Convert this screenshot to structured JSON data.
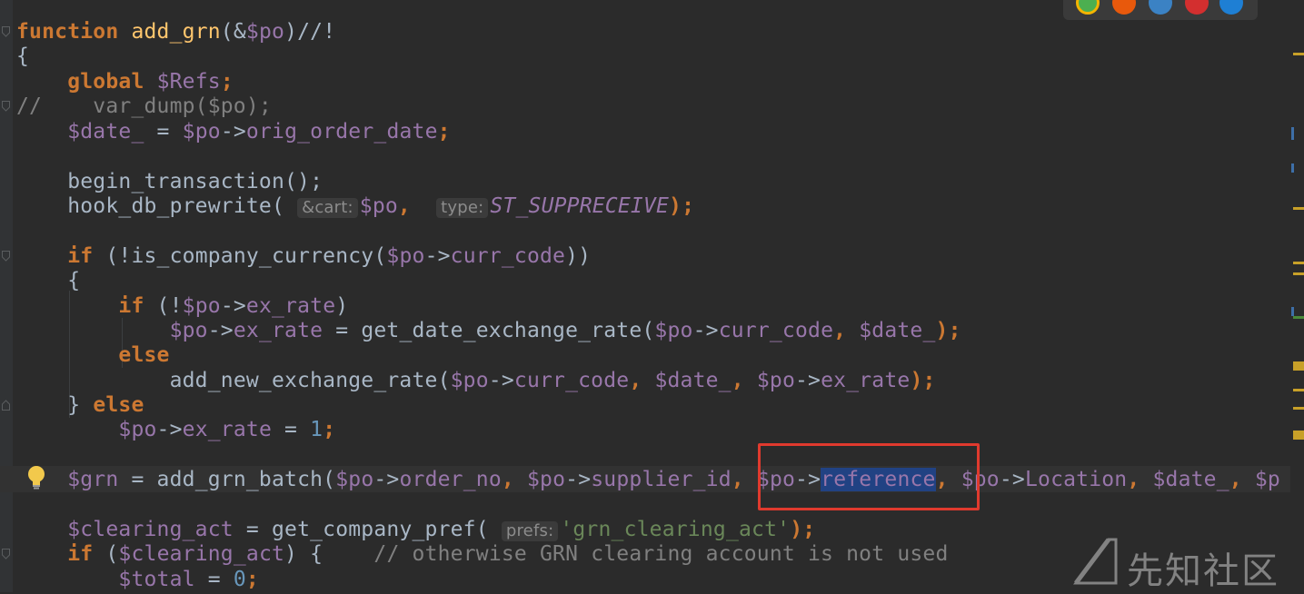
{
  "code": {
    "l1": {
      "kw": "function",
      "fn": "add_grn",
      "a": "(&",
      "v": "$po",
      "b": ")//!"
    },
    "l2": "{",
    "l3": {
      "kw": "global",
      "v": "$Refs",
      "b": ";"
    },
    "l4": {
      "c": "//    var_dump($po);"
    },
    "l5": {
      "v1": "$date_",
      "a": " = ",
      "v2": "$po",
      "arrow": "->",
      "p": "orig_order_date",
      "b": ";"
    },
    "l7": {
      "a": "begin_transaction();"
    },
    "l8": {
      "a": "hook_db_prewrite(",
      "h1": "&cart:",
      "v": "$po",
      "b": ",",
      "h2": "type:",
      "c": "ST_SUPPRECEIVE",
      "d": ");"
    },
    "l10": {
      "kw": "if",
      "a": " (!is_company_currency(",
      "v": "$po",
      "arrow": "->",
      "p": "curr_code",
      "b": "))"
    },
    "l11": "{",
    "l12": {
      "kw": "if",
      "a": " (!",
      "v": "$po",
      "arrow": "->",
      "p": "ex_rate",
      "b": ")"
    },
    "l13": {
      "v1": "$po",
      "arrow1": "->",
      "p1": "ex_rate",
      "a": " = get_date_exchange_rate(",
      "v2": "$po",
      "arrow2": "->",
      "p2": "curr_code",
      "b": ", ",
      "v3": "$date_",
      "c": ");"
    },
    "l14": {
      "kw": "else"
    },
    "l15": {
      "a": "add_new_exchange_rate(",
      "v1": "$po",
      "arrow1": "->",
      "p1": "curr_code",
      "b": ", ",
      "v2": "$date_",
      "c": ", ",
      "v3": "$po",
      "arrow2": "->",
      "p2": "ex_rate",
      "d": ");"
    },
    "l16": {
      "a": "} ",
      "kw": "else"
    },
    "l17": {
      "v": "$po",
      "arrow": "->",
      "p": "ex_rate",
      "a": " = ",
      "n": "1",
      "b": ";"
    },
    "l19": {
      "v1": "$grn",
      "a": " = add_grn_batch(",
      "v2": "$po",
      "arrow1": "->",
      "p1": "order_no",
      "b": ", ",
      "v3": "$po",
      "arrow2": "->",
      "p2": "supplier_id",
      "c": ", ",
      "v4": "$po",
      "arrow3": "->",
      "p3": "reference",
      "d": ", ",
      "v5": "$po",
      "arrow4": "->",
      "p4": "Location",
      "e": ", ",
      "v6": "$date_",
      "f": ", ",
      "v7": "$p"
    },
    "l21": {
      "v": "$clearing_act",
      "a": " = get_company_pref(",
      "h": "prefs:",
      "s": "'grn_clearing_act'",
      "b": ");"
    },
    "l22": {
      "kw": "if",
      "a": " (",
      "v": "$clearing_act",
      "b": ") {    ",
      "c": "// otherwise GRN clearing account is not used"
    },
    "l23": {
      "v": "$total",
      "a": " = ",
      "n": "0",
      "b": ";"
    }
  },
  "watermark": {
    "text": "先知社区"
  },
  "colors": {
    "keyword": "#cc7832",
    "function": "#ffc66d",
    "variable": "#9876aa",
    "string": "#6a8759",
    "number": "#6897bb",
    "comment": "#808080",
    "highlight_box": "#e03a2e",
    "selection": "#214283"
  },
  "icons": {
    "bulb": "lightbulb-icon",
    "browsers": [
      "chrome-icon",
      "firefox-icon",
      "safari-icon",
      "opera-icon",
      "edge-icon"
    ]
  }
}
